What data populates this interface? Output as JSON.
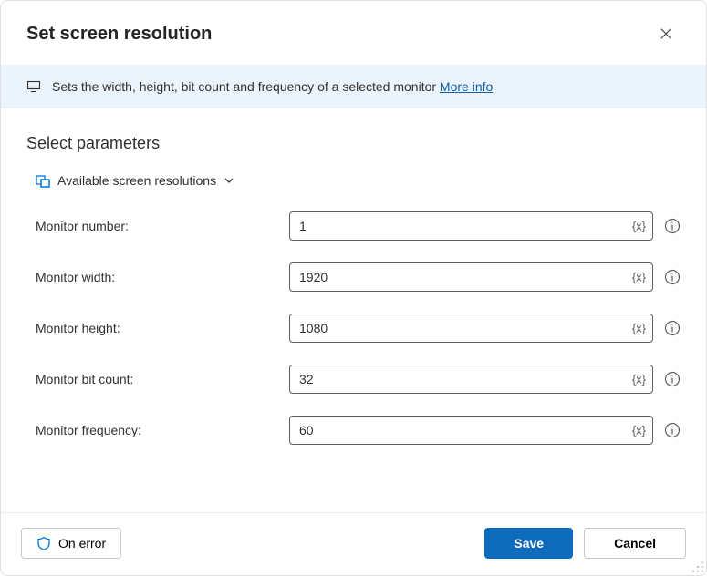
{
  "title": "Set screen resolution",
  "info": {
    "text": "Sets the width, height, bit count and frequency of a selected monitor ",
    "link": "More info"
  },
  "section": "Select parameters",
  "variablesButton": "Available screen resolutions",
  "varToken": "{x}",
  "fields": [
    {
      "label": "Monitor number:",
      "value": "1"
    },
    {
      "label": "Monitor width:",
      "value": "1920"
    },
    {
      "label": "Monitor height:",
      "value": "1080"
    },
    {
      "label": "Monitor bit count:",
      "value": "32"
    },
    {
      "label": "Monitor frequency:",
      "value": "60"
    }
  ],
  "buttons": {
    "onError": "On error",
    "save": "Save",
    "cancel": "Cancel"
  }
}
